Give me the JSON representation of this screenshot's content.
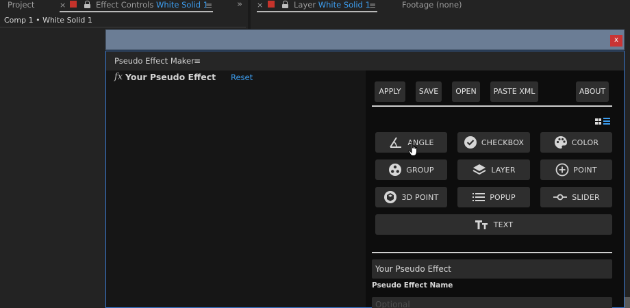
{
  "tabs": [
    {
      "label": "Project"
    },
    {
      "label": "Effect Controls",
      "target": "White Solid 1"
    },
    {
      "label": "Layer",
      "target": "White Solid 1"
    },
    {
      "label": "Footage",
      "target": "(none)"
    }
  ],
  "glyphs": {
    "close": "×",
    "menu": "≡",
    "more": "»"
  },
  "breadcrumb": "Comp 1 • White Solid 1",
  "window": {
    "close_label": "x"
  },
  "panel": {
    "title": "Pseudo Effect Maker",
    "menu": "≡",
    "fx": "fx",
    "effect_name": "Your Pseudo Effect",
    "reset_label": "Reset"
  },
  "toolbar": {
    "apply": "APPLY",
    "save": "SAVE",
    "open": "OPEN",
    "paste_xml": "PASTE XML",
    "about": "ABOUT"
  },
  "controls": [
    {
      "label": "ANGLE",
      "icon": "angle-icon"
    },
    {
      "label": "CHECKBOX",
      "icon": "checkbox-icon"
    },
    {
      "label": "COLOR",
      "icon": "palette-icon"
    },
    {
      "label": "GROUP",
      "icon": "group-icon"
    },
    {
      "label": "LAYER",
      "icon": "layers-icon"
    },
    {
      "label": "POINT",
      "icon": "point-icon"
    },
    {
      "label": "3D POINT",
      "icon": "cube-icon"
    },
    {
      "label": "POPUP",
      "icon": "list-icon"
    },
    {
      "label": "SLIDER",
      "icon": "slider-icon"
    },
    {
      "label": "TEXT",
      "icon": "text-icon"
    }
  ],
  "form": {
    "name_value": "Your Pseudo Effect",
    "name_label": "Pseudo Effect Name",
    "optional_placeholder": "Optional"
  },
  "colors": {
    "accent": "#3d9ef0",
    "window_title": "#6b7d95",
    "close": "#c93434",
    "button": "#2e2e2e",
    "tab_marker": "#c6332b"
  }
}
